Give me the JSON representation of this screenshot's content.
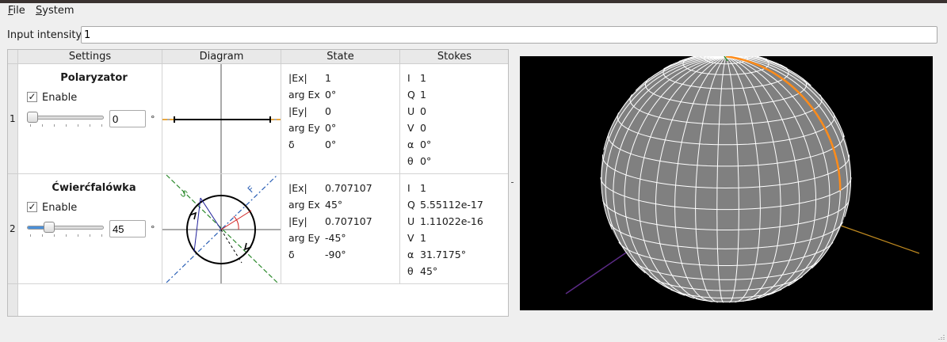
{
  "menu": {
    "file": {
      "first": "F",
      "rest": "ile"
    },
    "system": {
      "first": "S",
      "rest": "ystem"
    }
  },
  "input": {
    "label": "Input intensity",
    "value": "1"
  },
  "table": {
    "headers": [
      "Settings",
      "Diagram",
      "State",
      "Stokes"
    ],
    "rows": [
      {
        "index": "1",
        "title": "Polaryzator",
        "enable_label": "Enable",
        "enabled": true,
        "angle": "0",
        "slider_fraction": 0,
        "unit": "°",
        "state": [
          {
            "k": "|Ex|",
            "v": "1"
          },
          {
            "k": "arg Ex",
            "v": "0°"
          },
          {
            "k": "|Ey|",
            "v": "0"
          },
          {
            "k": "arg Ey",
            "v": "0°"
          },
          {
            "k": "δ",
            "v": "0°"
          }
        ],
        "stokes": [
          {
            "k": "I",
            "v": "1"
          },
          {
            "k": "Q",
            "v": "1"
          },
          {
            "k": "U",
            "v": "0"
          },
          {
            "k": "V",
            "v": "0"
          },
          {
            "k": "α",
            "v": "0°"
          },
          {
            "k": "θ",
            "v": "0°"
          }
        ]
      },
      {
        "index": "2",
        "title": "Ćwierćfalówka",
        "enable_label": "Enable",
        "enabled": true,
        "angle": "45",
        "slider_fraction": 0.25,
        "unit": "°",
        "diagram_labels": {
          "slow": "S",
          "fast": "F"
        },
        "state": [
          {
            "k": "|Ex|",
            "v": "0.707107"
          },
          {
            "k": "arg Ex",
            "v": "45°"
          },
          {
            "k": "|Ey|",
            "v": "0.707107"
          },
          {
            "k": "arg Ey",
            "v": "-45°"
          },
          {
            "k": "δ",
            "v": "-90°"
          }
        ],
        "stokes": [
          {
            "k": "I",
            "v": "1"
          },
          {
            "k": "Q",
            "v": "5.55112e-17"
          },
          {
            "k": "U",
            "v": "1.11022e-16"
          },
          {
            "k": "V",
            "v": "1"
          },
          {
            "k": "α",
            "v": "31.7175°"
          },
          {
            "k": "θ",
            "v": "45°"
          }
        ]
      }
    ]
  },
  "colors": {
    "sphere_fill": "#808080",
    "grid": "#ffffff",
    "trace": "#ff8c1a",
    "axis_q": "#5b2a86",
    "axis_u": "#c08a20",
    "slider_fill": "#4a90d9"
  }
}
